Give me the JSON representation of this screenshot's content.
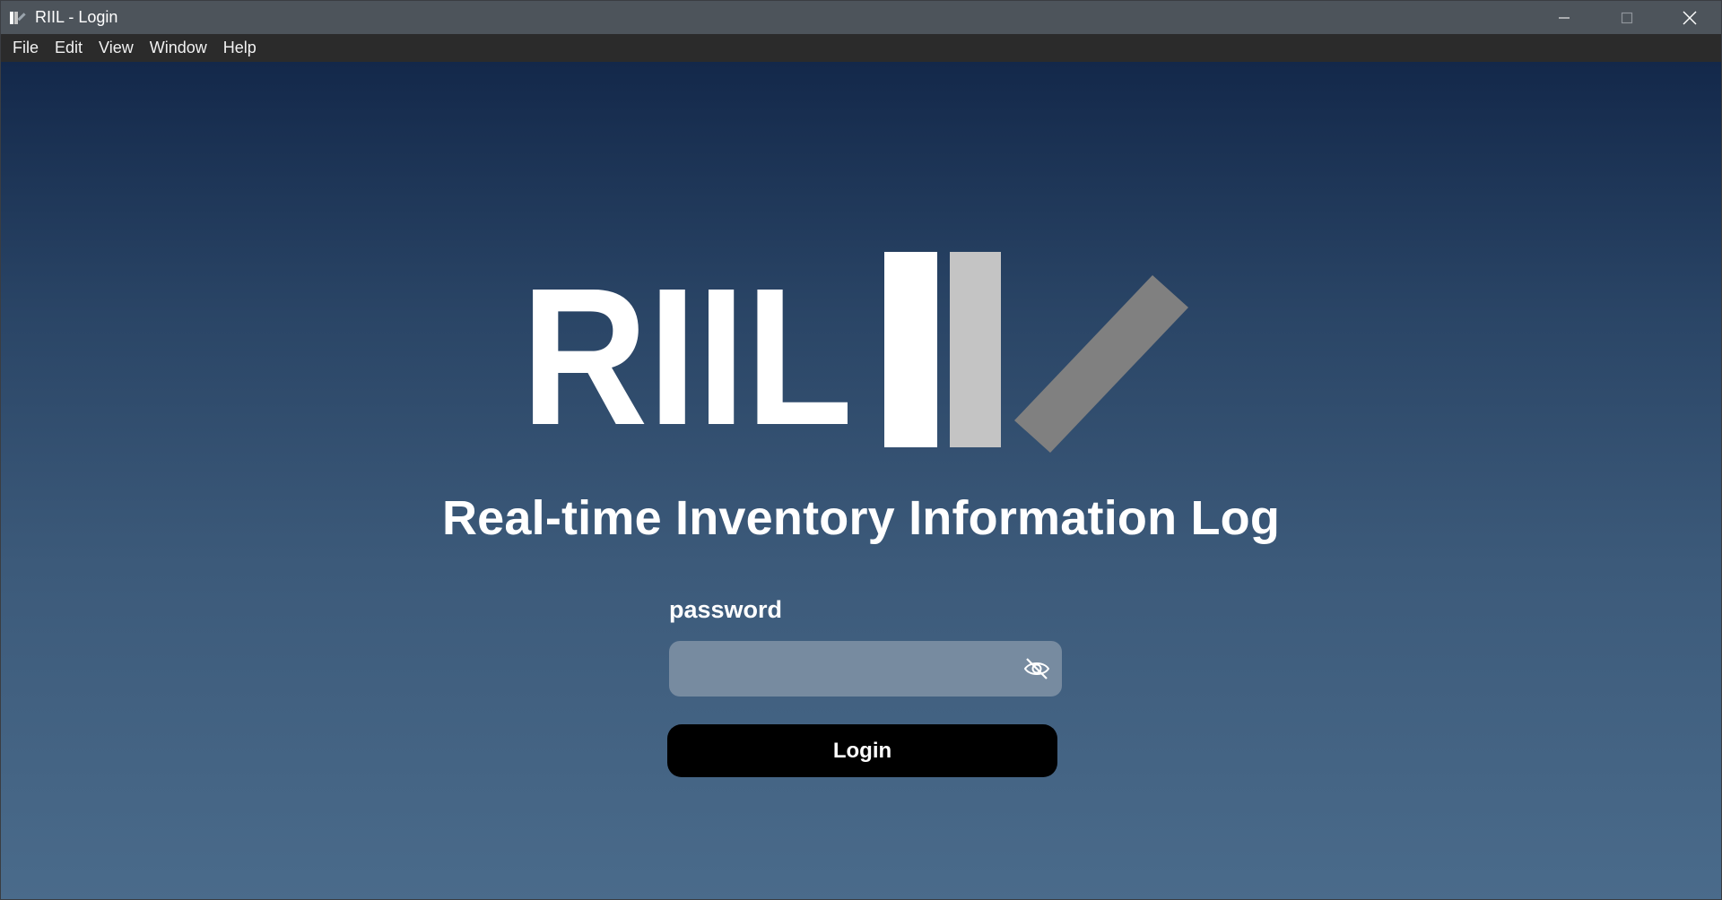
{
  "window": {
    "title": "RIIL - Login",
    "controls": {
      "minimize": "minimize",
      "maximize": "maximize",
      "close": "close"
    }
  },
  "menu": {
    "items": [
      {
        "label": "File"
      },
      {
        "label": "Edit"
      },
      {
        "label": "View"
      },
      {
        "label": "Window"
      },
      {
        "label": "Help"
      }
    ]
  },
  "logo": {
    "text": "RIIL",
    "icon": "riil-logo-mark"
  },
  "main": {
    "subtitle": "Real-time Inventory Information Log",
    "password_label": "password",
    "password_value": "",
    "toggle_icon": "eye-slash-icon",
    "login_label": "Login"
  },
  "colors": {
    "titlebar": "#4d545b",
    "menubar": "#2b2b2b",
    "gradient_top": "#13284a",
    "gradient_bottom": "#4a6b8b",
    "field_bg": "#778ba0",
    "button_bg": "#000000",
    "logo_white": "#ffffff",
    "logo_lightgray": "#c4c4c4",
    "logo_gray": "#808080"
  }
}
